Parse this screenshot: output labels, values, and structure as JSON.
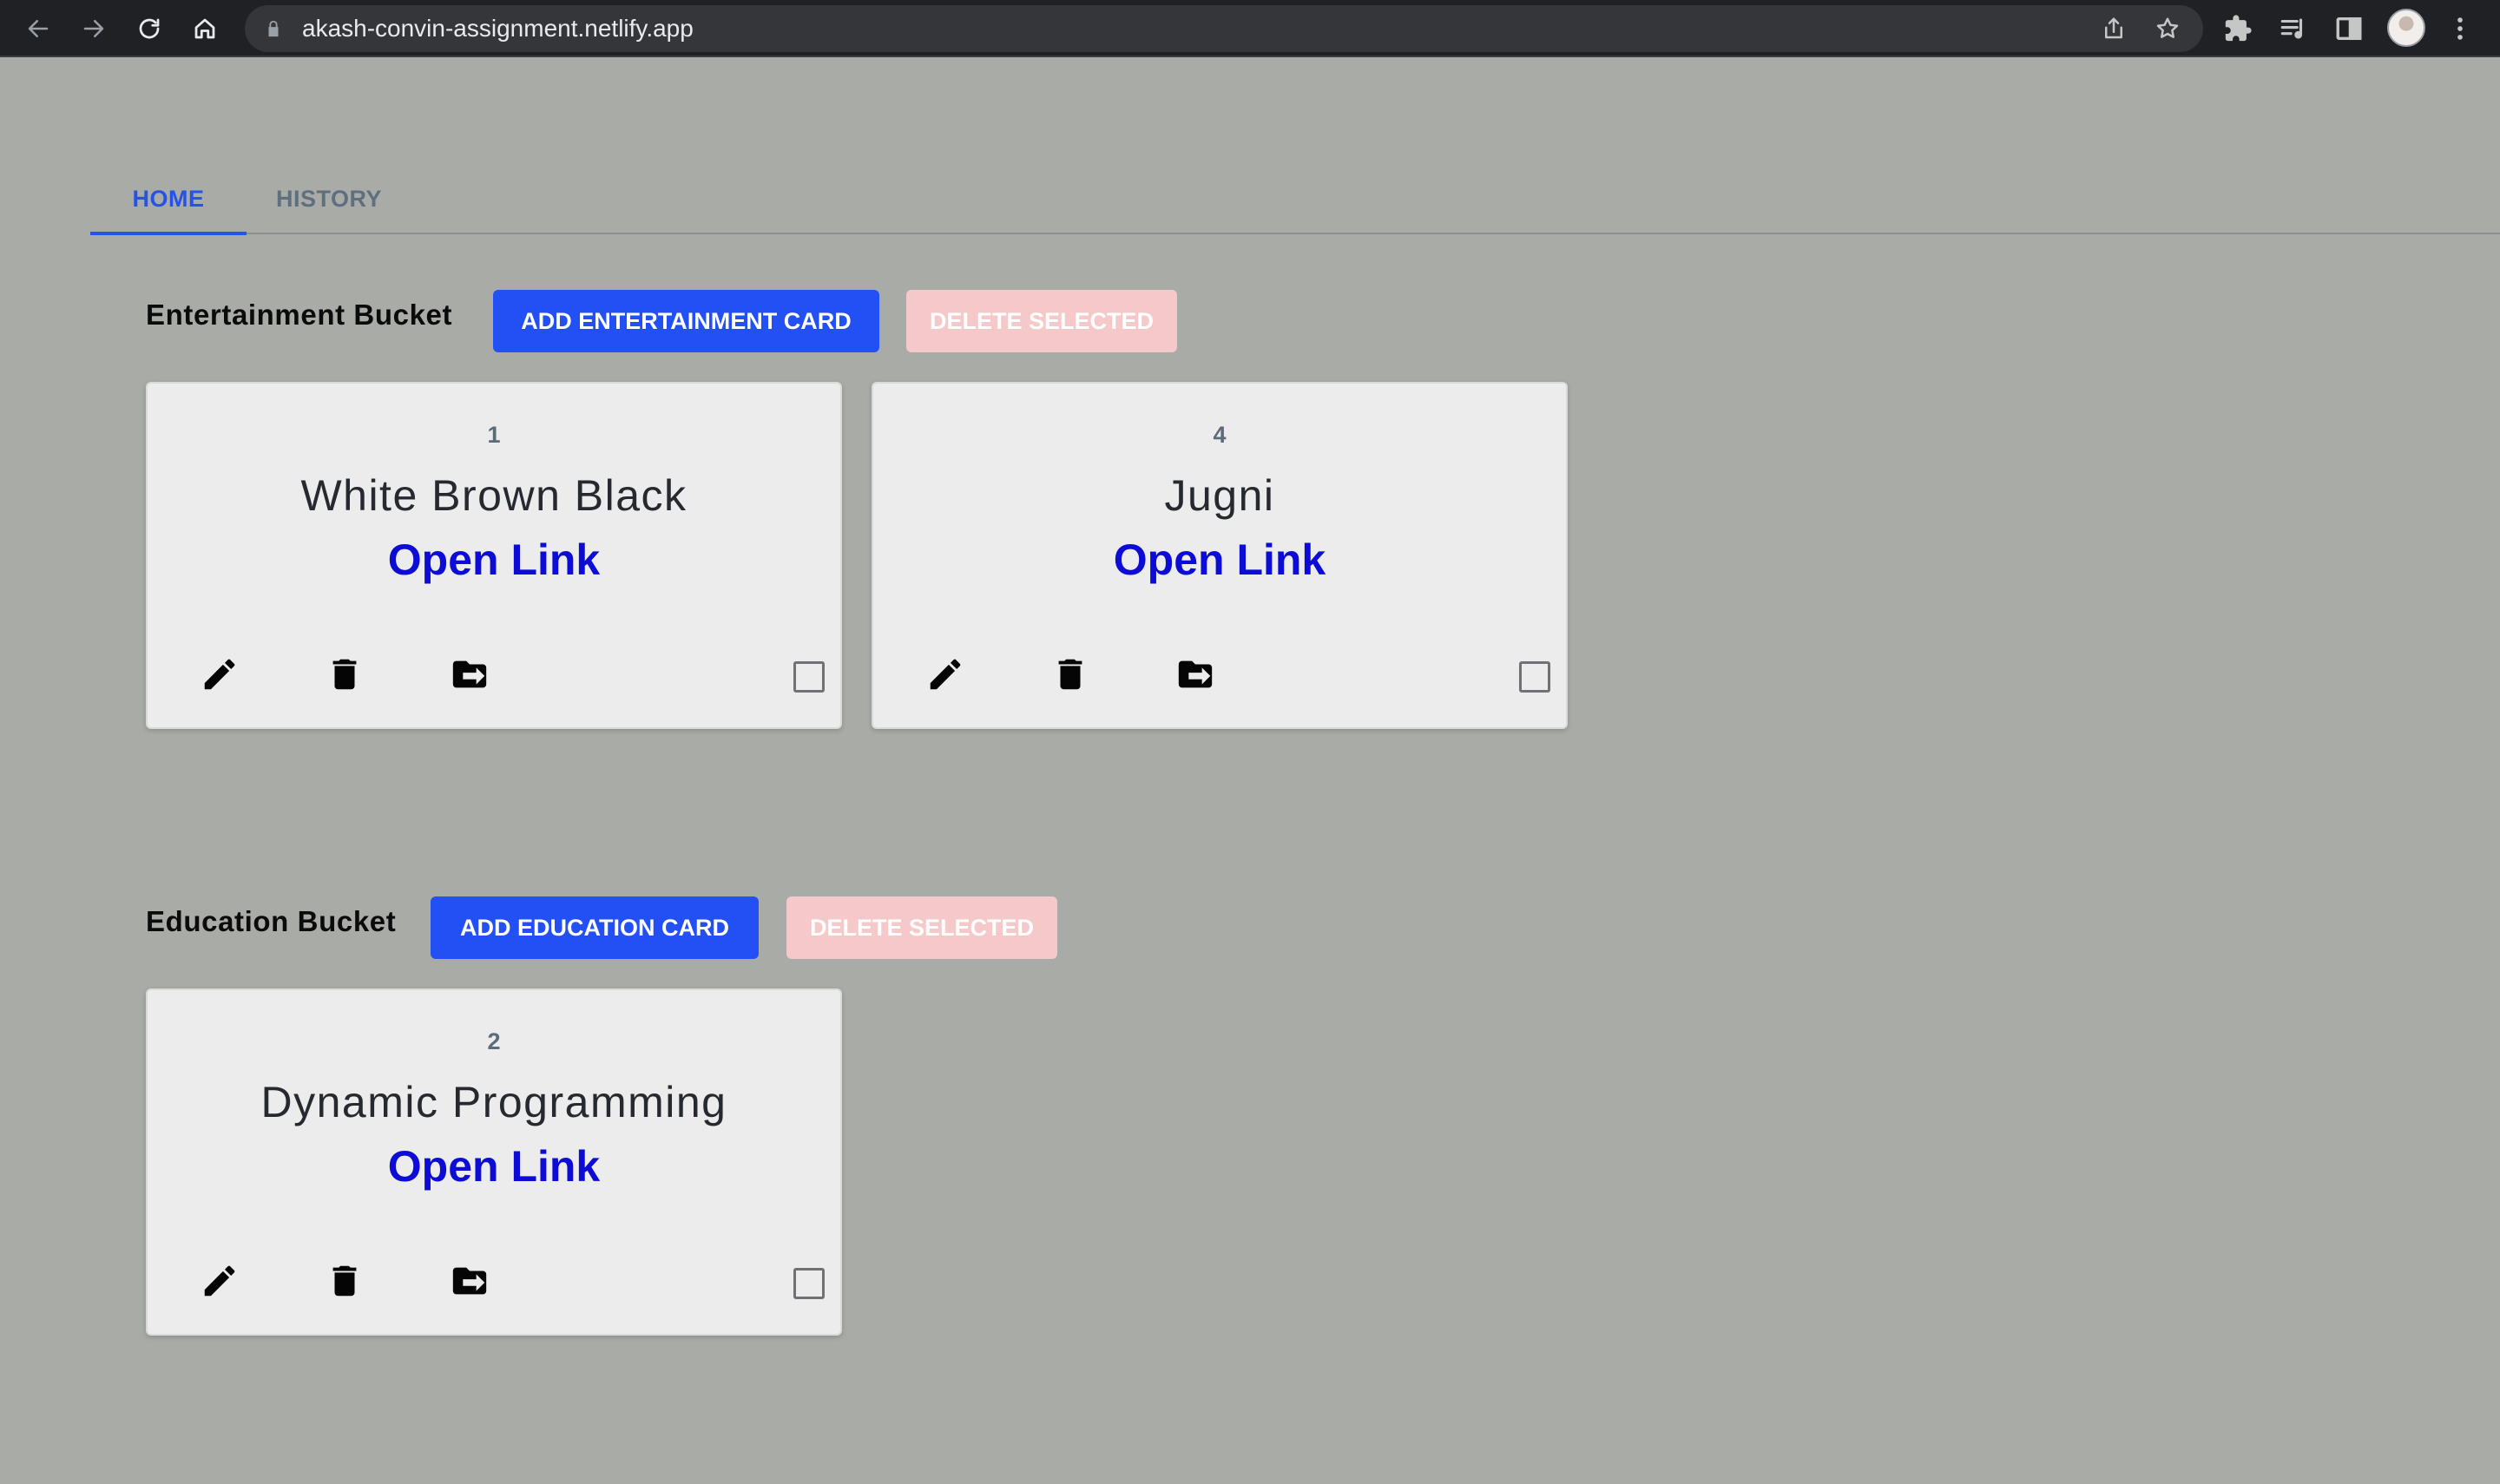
{
  "browser": {
    "url": "akash-convin-assignment.netlify.app",
    "back_icon": "arrow-left-icon",
    "forward_icon": "arrow-right-icon",
    "reload_icon": "reload-icon",
    "home_icon": "home-icon"
  },
  "tabs": [
    {
      "label": "HOME",
      "active": true
    },
    {
      "label": "HISTORY",
      "active": false
    }
  ],
  "buckets": [
    {
      "title": "Entertainment Bucket",
      "add_label": "ADD ENTERTAINMENT CARD",
      "delete_label": "DELETE SELECTED",
      "cards": [
        {
          "id": "1",
          "title": "White Brown Black",
          "link_label": "Open Link"
        },
        {
          "id": "4",
          "title": "Jugni",
          "link_label": "Open Link"
        }
      ]
    },
    {
      "title": "Education Bucket",
      "add_label": "ADD EDUCATION CARD",
      "delete_label": "DELETE SELECTED",
      "cards": [
        {
          "id": "2",
          "title": "Dynamic Programming",
          "link_label": "Open Link"
        }
      ]
    }
  ],
  "colors": {
    "background": "#a9aca6",
    "primary": "#2250f4",
    "disabled": "#f5c9c9",
    "link": "#0d0bd6",
    "tab_active": "#2653e6"
  }
}
